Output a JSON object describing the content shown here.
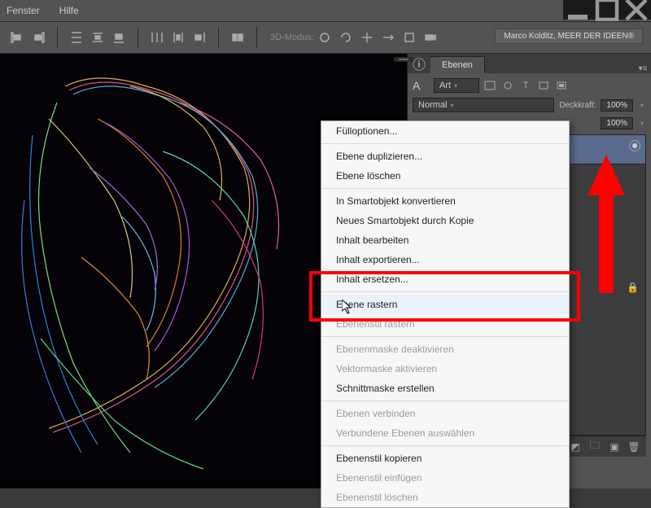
{
  "menu": {
    "fenster": "Fenster",
    "hilfe": "Hilfe"
  },
  "options": {
    "mode3d": "3D-Modus:",
    "user_badge": "Marco Kolditz, MEER DER IDEEN®"
  },
  "panels": {
    "ebenen_tab": "Ebenen",
    "filter_kind": "Art",
    "blend_mode": "Normal",
    "opacity_label": "Deckkraft:",
    "opacity_value": "100%",
    "fill_value": "100%"
  },
  "context_menu": {
    "items": [
      {
        "label": "Fülloptionen...",
        "disabled": false
      },
      {
        "sep": true
      },
      {
        "label": "Ebene duplizieren...",
        "disabled": false
      },
      {
        "label": "Ebene löschen",
        "disabled": false
      },
      {
        "sep": true
      },
      {
        "label": "In Smartobjekt konvertieren",
        "disabled": false
      },
      {
        "label": "Neues Smartobjekt durch Kopie",
        "disabled": false
      },
      {
        "label": "Inhalt bearbeiten",
        "disabled": false
      },
      {
        "label": "Inhalt exportieren...",
        "disabled": false
      },
      {
        "label": "Inhalt ersetzen...",
        "disabled": false
      },
      {
        "sep": true
      },
      {
        "label": "Ebene rastern",
        "disabled": false,
        "highlighted": true
      },
      {
        "label": "Ebenenstil rastern",
        "disabled": true
      },
      {
        "sep": true
      },
      {
        "label": "Ebenenmaske deaktivieren",
        "disabled": true
      },
      {
        "label": "Vektormaske aktivieren",
        "disabled": true
      },
      {
        "label": "Schnittmaske erstellen",
        "disabled": false
      },
      {
        "sep": true
      },
      {
        "label": "Ebenen verbinden",
        "disabled": true
      },
      {
        "label": "Verbundene Ebenen auswählen",
        "disabled": true
      },
      {
        "sep": true
      },
      {
        "label": "Ebenenstil kopieren",
        "disabled": false
      },
      {
        "label": "Ebenenstil einfügen",
        "disabled": true
      },
      {
        "label": "Ebenenstil löschen",
        "disabled": true
      }
    ]
  },
  "icons": {
    "search": "search-icon",
    "info": "ⓘ",
    "char_panel": "A"
  }
}
